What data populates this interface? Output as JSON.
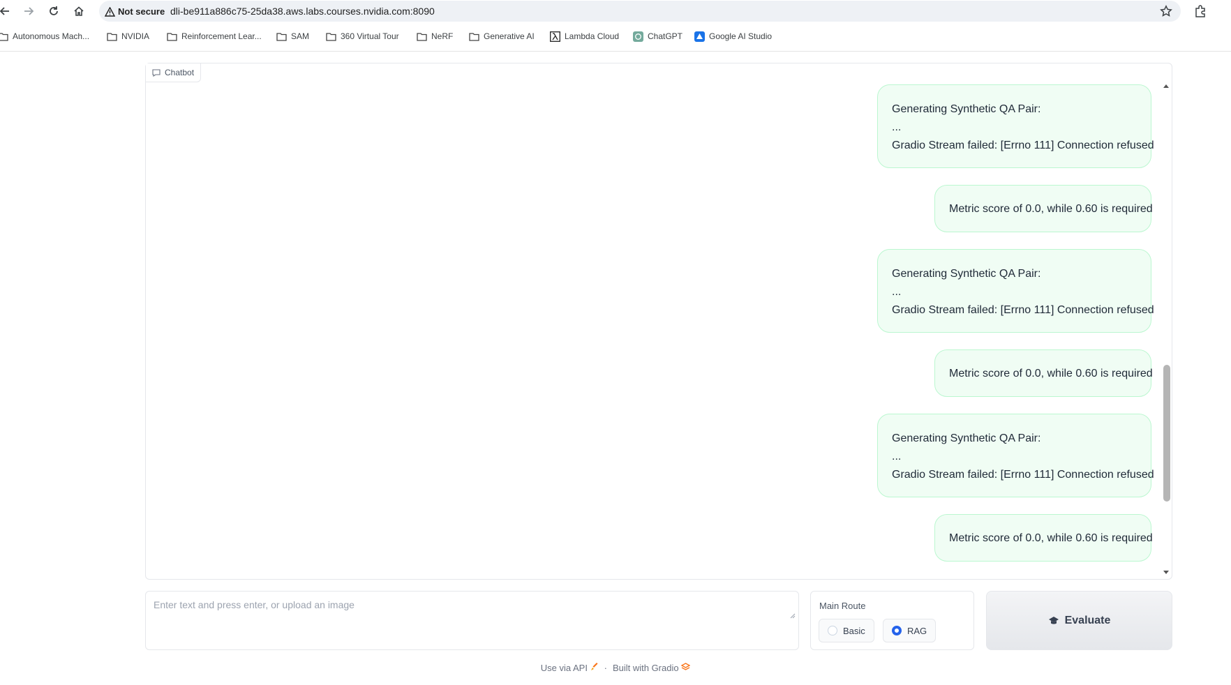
{
  "browser": {
    "security_label": "Not secure",
    "url": "dli-be911a886c75-25da38.aws.labs.courses.nvidia.com:8090",
    "bookmarks": [
      {
        "label": "Autonomous Mach...",
        "icon": "folder-icon"
      },
      {
        "label": "NVIDIA",
        "icon": "folder-icon"
      },
      {
        "label": "Reinforcement Lear...",
        "icon": "folder-icon"
      },
      {
        "label": "SAM",
        "icon": "folder-icon"
      },
      {
        "label": "360 Virtual Tour",
        "icon": "folder-icon"
      },
      {
        "label": "NeRF",
        "icon": "folder-icon"
      },
      {
        "label": "Generative AI",
        "icon": "folder-icon"
      },
      {
        "label": "Lambda Cloud",
        "icon": "lambda-icon"
      },
      {
        "label": "ChatGPT",
        "icon": "chatgpt-icon"
      },
      {
        "label": "Google AI Studio",
        "icon": "ai-studio-icon"
      }
    ]
  },
  "chatbot": {
    "label": "Chatbot",
    "messages": [
      {
        "lines": [
          "Generating Synthetic QA Pair:",
          "...",
          "Gradio Stream failed: [Errno 111] Connection refused"
        ]
      },
      {
        "lines": [
          "Metric score of 0.0, while 0.60 is required"
        ]
      },
      {
        "lines": [
          "Generating Synthetic QA Pair:",
          "...",
          "Gradio Stream failed: [Errno 111] Connection refused"
        ]
      },
      {
        "lines": [
          "Metric score of 0.0, while 0.60 is required"
        ]
      },
      {
        "lines": [
          "Generating Synthetic QA Pair:",
          "...",
          "Gradio Stream failed: [Errno 111] Connection refused"
        ]
      },
      {
        "lines": [
          "Metric score of 0.0, while 0.60 is required"
        ]
      }
    ]
  },
  "input": {
    "placeholder": "Enter text and press enter, or upload an image",
    "value": ""
  },
  "route": {
    "title": "Main Route",
    "options": [
      "Basic",
      "RAG"
    ],
    "selected": "RAG"
  },
  "evaluate": {
    "label": "Evaluate",
    "icon": "graduation-cap-icon"
  },
  "footer": {
    "api_label": "Use via API",
    "separator": "·",
    "built_label": "Built with Gradio"
  },
  "colors": {
    "message_bg": "#f0fdf4",
    "message_border": "#bbf7d0",
    "radio_accent": "#2563eb"
  }
}
